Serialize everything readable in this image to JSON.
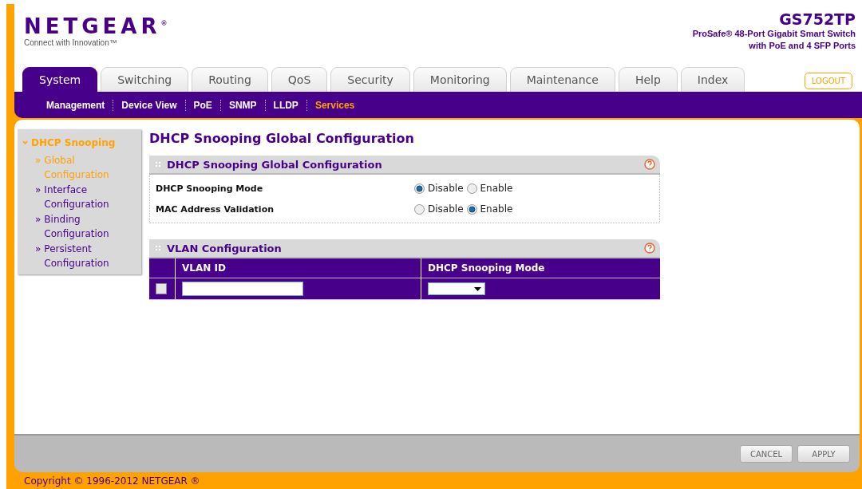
{
  "brand": {
    "logo": "NETGEAR",
    "registered": "®",
    "tagline": "Connect with Innovation™"
  },
  "product": {
    "model": "GS752TP",
    "description": [
      "ProSafe® 48-Port Gigabit Smart Switch",
      "with PoE and 4 SFP Ports"
    ]
  },
  "tabs": [
    {
      "label": "System",
      "selected": true
    },
    {
      "label": "Switching",
      "selected": false
    },
    {
      "label": "Routing",
      "selected": false
    },
    {
      "label": "QoS",
      "selected": false
    },
    {
      "label": "Security",
      "selected": false
    },
    {
      "label": "Monitoring",
      "selected": false
    },
    {
      "label": "Maintenance",
      "selected": false
    },
    {
      "label": "Help",
      "selected": false
    },
    {
      "label": "Index",
      "selected": false
    }
  ],
  "logout": "LOGOUT",
  "subtabs": [
    {
      "label": "Management",
      "selected": false
    },
    {
      "label": "Device View",
      "selected": false
    },
    {
      "label": "PoE",
      "selected": false
    },
    {
      "label": "SNMP",
      "selected": false
    },
    {
      "label": "LLDP",
      "selected": false
    },
    {
      "label": "Services",
      "selected": true
    }
  ],
  "sidebar": {
    "heading": "DHCP Snooping",
    "expanded": true,
    "items": [
      {
        "marker": "»",
        "label": "Global Configuration",
        "selected": true
      },
      {
        "marker": "»",
        "label": "Interface Configuration",
        "selected": false
      },
      {
        "marker": "»",
        "label": "Binding Configuration",
        "selected": false
      },
      {
        "marker": "»",
        "label": "Persistent Configuration",
        "selected": false
      }
    ]
  },
  "page_title": "DHCP Snooping Global Configuration",
  "global_panel": {
    "title": "DHCP Snooping Global Configuration",
    "rows": [
      {
        "label": "DHCP Snooping Mode",
        "options": [
          {
            "label": "Disable",
            "selected": true
          },
          {
            "label": "Enable",
            "selected": false
          }
        ]
      },
      {
        "label": "MAC Address Validation",
        "options": [
          {
            "label": "Disable",
            "selected": false
          },
          {
            "label": "Enable",
            "selected": true
          }
        ]
      }
    ]
  },
  "vlan_panel": {
    "title": "VLAN Configuration",
    "columns": [
      "VLAN ID",
      "DHCP Snooping Mode"
    ],
    "rows": [
      {
        "checked": false
      }
    ]
  },
  "buttons": [
    "CANCEL",
    "APPLY"
  ],
  "copyright": "Copyright © 1996-2012 NETGEAR ®"
}
